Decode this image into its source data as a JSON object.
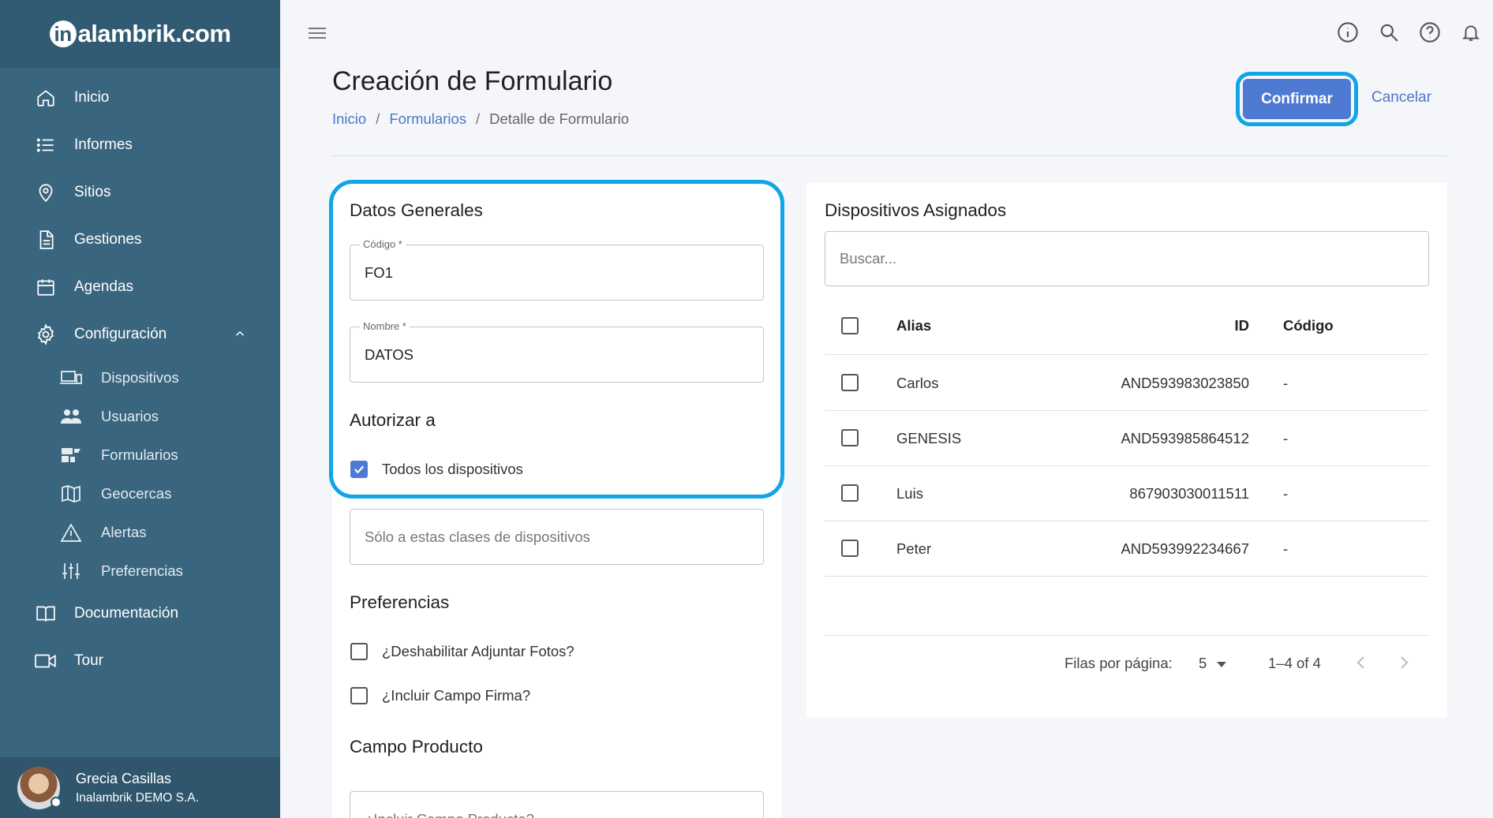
{
  "app": {
    "logo_text": "alambrik.com",
    "logo_letter": "in"
  },
  "sidebar": {
    "items": [
      {
        "label": "Inicio",
        "icon": "home-icon"
      },
      {
        "label": "Informes",
        "icon": "list-icon"
      },
      {
        "label": "Sitios",
        "icon": "location-icon"
      },
      {
        "label": "Gestiones",
        "icon": "document-icon"
      },
      {
        "label": "Agendas",
        "icon": "calendar-icon"
      },
      {
        "label": "Configuración",
        "icon": "gear-icon"
      }
    ],
    "sub_items": [
      {
        "label": "Dispositivos",
        "icon": "devices-icon"
      },
      {
        "label": "Usuarios",
        "icon": "users-icon"
      },
      {
        "label": "Formularios",
        "icon": "forms-icon"
      },
      {
        "label": "Geocercas",
        "icon": "map-icon"
      },
      {
        "label": "Alertas",
        "icon": "warning-icon"
      },
      {
        "label": "Preferencias",
        "icon": "sliders-icon"
      }
    ],
    "bottom_items": [
      {
        "label": "Documentación",
        "icon": "book-icon"
      },
      {
        "label": "Tour",
        "icon": "video-icon"
      }
    ],
    "user": {
      "name": "Grecia Casillas",
      "company": "Inalambrik DEMO S.A."
    }
  },
  "header": {
    "title": "Creación de Formulario",
    "breadcrumb": [
      "Inicio",
      "Formularios",
      "Detalle de Formulario"
    ],
    "confirm_label": "Confirmar",
    "cancel_label": "Cancelar"
  },
  "form": {
    "general_title": "Datos Generales",
    "codigo_label": "Código *",
    "codigo_value": "FO1",
    "nombre_label": "Nombre *",
    "nombre_value": "DATOS",
    "autorizar_title": "Autorizar a",
    "todos_label": "Todos los dispositivos",
    "todos_checked": true,
    "clases_placeholder": "Sólo a estas clases de dispositivos",
    "preferencias_title": "Preferencias",
    "pref_fotos_label": "¿Deshabilitar Adjuntar Fotos?",
    "pref_firma_label": "¿Incluir Campo Firma?",
    "producto_title": "Campo Producto",
    "producto_placeholder": "¿Incluir Campo Producto?"
  },
  "devices": {
    "title": "Dispositivos Asignados",
    "search_placeholder": "Buscar...",
    "columns": {
      "alias": "Alias",
      "id": "ID",
      "codigo": "Código"
    },
    "rows": [
      {
        "alias": "Carlos",
        "id": "AND593983023850",
        "codigo": "-"
      },
      {
        "alias": "GENESIS",
        "id": "AND593985864512",
        "codigo": "-"
      },
      {
        "alias": "Luis",
        "id": "867903030011511",
        "codigo": "-"
      },
      {
        "alias": "Peter",
        "id": "AND593992234667",
        "codigo": "-"
      }
    ],
    "pager": {
      "rows_label": "Filas por página:",
      "rows_value": "5",
      "range": "1–4 of 4"
    }
  },
  "colors": {
    "sidebar": "#3a657e",
    "accent": "#4f7ad4",
    "highlight": "#10a5e6"
  }
}
